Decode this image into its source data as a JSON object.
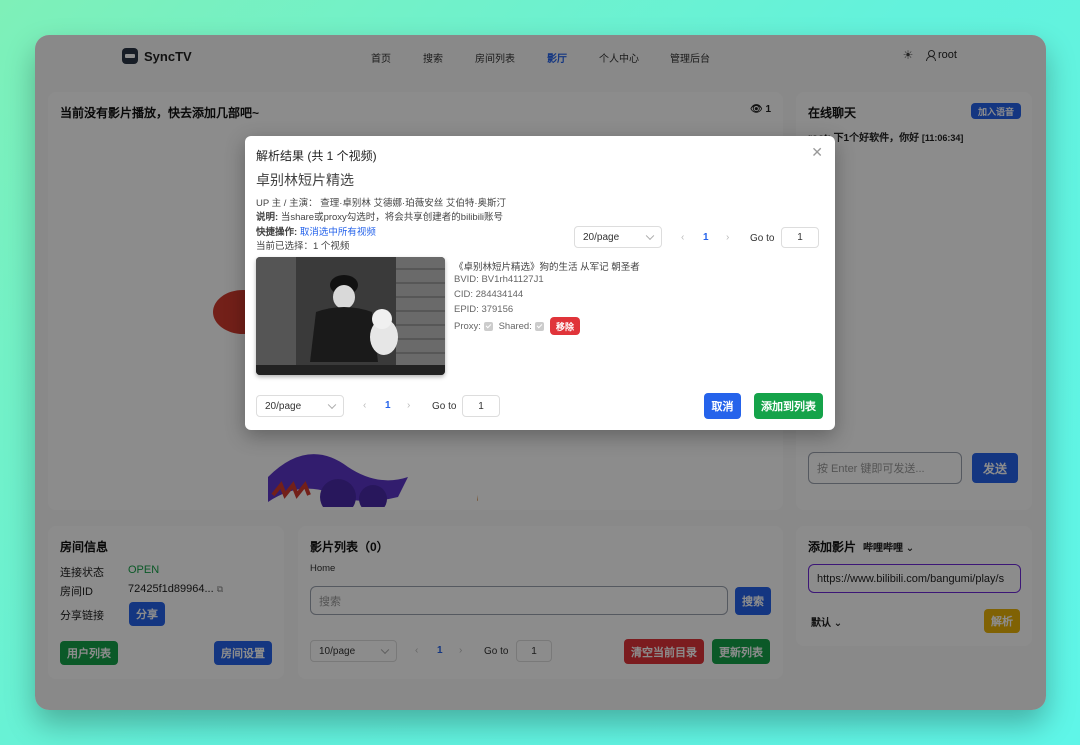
{
  "nav": {
    "brand": "SyncTV",
    "links": [
      "首页",
      "搜索",
      "房间列表",
      "影厅",
      "个人中心",
      "管理后台"
    ],
    "user": "root"
  },
  "player": {
    "title": "当前没有影片播放，快去添加几部吧~",
    "viewers": "1"
  },
  "chat": {
    "title": "在线聊天",
    "voice_button": "加入语音",
    "message_user": "root:",
    "message_text": "下1个好软件，你好",
    "message_time": "[11:06:34]",
    "input_placeholder": "按 Enter 键即可发送...",
    "send_button": "发送"
  },
  "room": {
    "title": "房间信息",
    "status_label": "连接状态",
    "status_value": "OPEN",
    "id_label": "房间ID",
    "id_value": "72425f1d89964...",
    "share_label": "分享链接",
    "share_button": "分享",
    "users_button": "用户列表",
    "settings_button": "房间设置"
  },
  "movies": {
    "title": "影片列表（0）",
    "breadcrumb": "Home",
    "search_placeholder": "搜索",
    "search_button": "搜索",
    "page_size": "10/page",
    "page_current": "1",
    "goto_label": "Go to",
    "goto_value": "1",
    "clear_button": "清空当前目录",
    "refresh_button": "更新列表"
  },
  "add": {
    "title": "添加影片",
    "source": "哔哩哔哩",
    "url_value": "https://www.bilibili.com/bangumi/play/s",
    "mode": "默认",
    "parse_button": "解析"
  },
  "modal": {
    "heading": "解析结果 (共 1 个视频)",
    "title": "卓别林短片精选",
    "up_line": "UP 主 / 主演： 查理·卓别林 艾德娜·珀薇安丝 艾伯特·奥斯汀",
    "desc_label": "说明:",
    "desc_text": "当share或proxy勾选时，将会共享创建者的bilibili账号",
    "quick_label": "快捷操作:",
    "quick_link": "取消选中所有视频",
    "selected": "当前已选择：1 个视频",
    "top_page_size": "20/page",
    "top_page_current": "1",
    "top_goto_label": "Go to",
    "top_goto_value": "1",
    "item": {
      "name": "《卓别林短片精选》狗的生活 从军记 朝圣者",
      "bvid": "BVID: BV1rh41127J1",
      "cid": "CID: 284434144",
      "epid": "EPID: 379156",
      "proxy_label": "Proxy:",
      "shared_label": "Shared:",
      "remove_button": "移除"
    },
    "bottom_page_size": "20/page",
    "bottom_page_current": "1",
    "bottom_goto_label": "Go to",
    "bottom_goto_value": "1",
    "cancel_button": "取消",
    "add_button": "添加到列表"
  }
}
